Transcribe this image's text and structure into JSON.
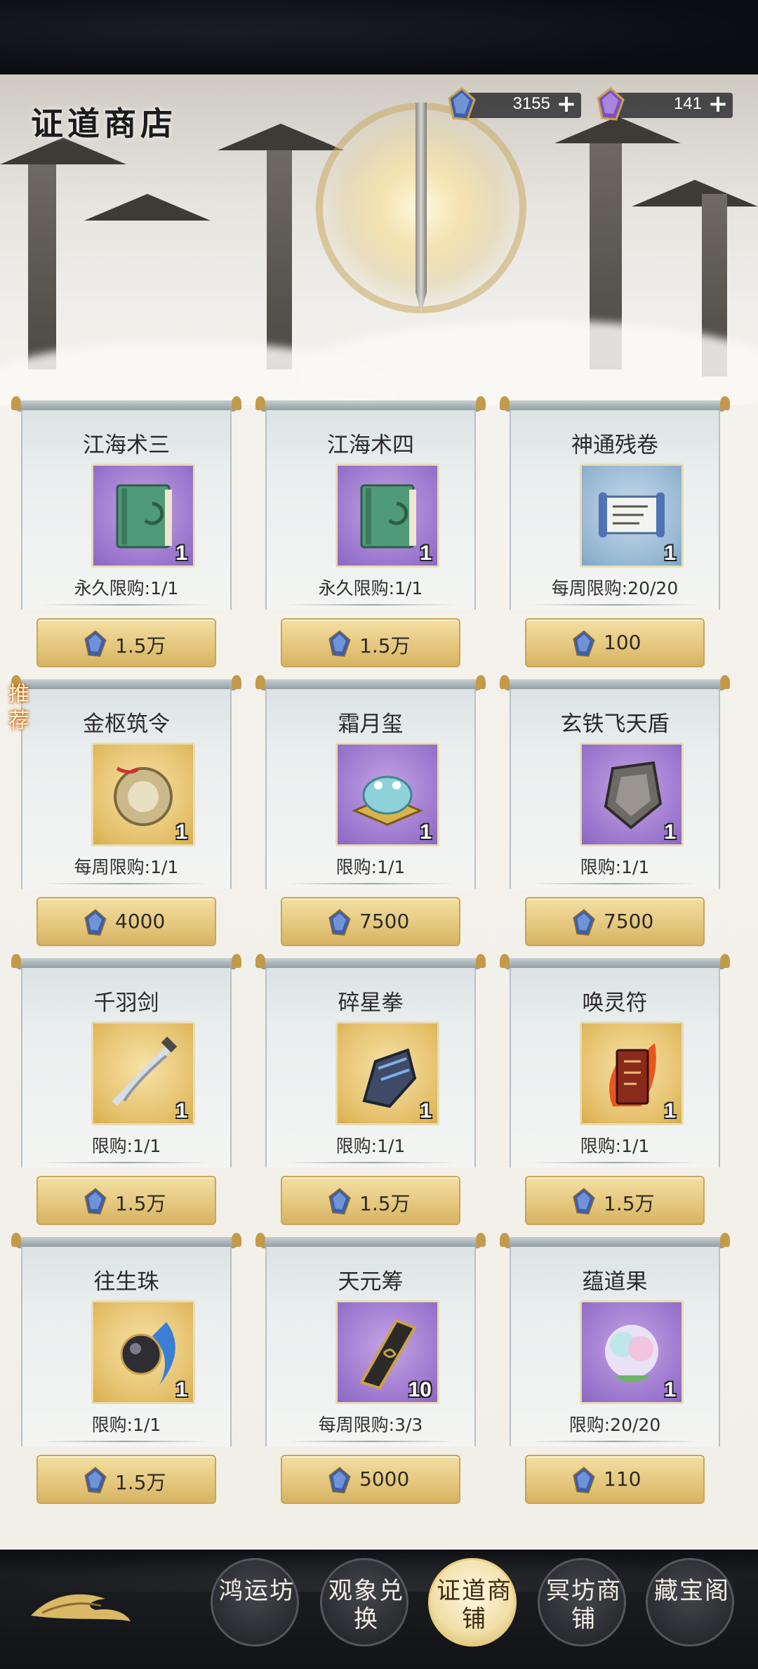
{
  "header": {
    "title": "证道商店",
    "currencies": [
      {
        "icon": "blue-crystal-icon",
        "amount": "3155",
        "plus": "+"
      },
      {
        "icon": "purple-crystal-icon",
        "amount": "141",
        "plus": "+"
      }
    ]
  },
  "recommend_tag": "推荐",
  "items": [
    {
      "name": "江海术三",
      "icon": "green-book-icon",
      "rarity": "purple",
      "qty": "1",
      "limit": "永久限购:1/1",
      "price": "1.5万"
    },
    {
      "name": "江海术四",
      "icon": "green-book-icon",
      "rarity": "purple",
      "qty": "1",
      "limit": "永久限购:1/1",
      "price": "1.5万"
    },
    {
      "name": "神通残卷",
      "icon": "scroll-icon",
      "rarity": "blue",
      "qty": "1",
      "limit": "每周限购:20/20",
      "price": "100"
    },
    {
      "name": "金枢筑令",
      "icon": "golden-token-icon",
      "rarity": "gold",
      "qty": "1",
      "limit": "每周限购:1/1",
      "price": "4000"
    },
    {
      "name": "霜月玺",
      "icon": "frog-seal-icon",
      "rarity": "purple",
      "qty": "1",
      "limit": "限购:1/1",
      "price": "7500"
    },
    {
      "name": "玄铁飞天盾",
      "icon": "shield-icon",
      "rarity": "purple",
      "qty": "1",
      "limit": "限购:1/1",
      "price": "7500"
    },
    {
      "name": "千羽剑",
      "icon": "feather-sword-icon",
      "rarity": "gold",
      "qty": "1",
      "limit": "限购:1/1",
      "price": "1.5万"
    },
    {
      "name": "碎星拳",
      "icon": "gauntlet-icon",
      "rarity": "gold",
      "qty": "1",
      "limit": "限购:1/1",
      "price": "1.5万"
    },
    {
      "name": "唤灵符",
      "icon": "flame-talisman-icon",
      "rarity": "gold",
      "qty": "1",
      "limit": "限购:1/1",
      "price": "1.5万"
    },
    {
      "name": "往生珠",
      "icon": "orb-icon",
      "rarity": "gold",
      "qty": "1",
      "limit": "限购:1/1",
      "price": "1.5万"
    },
    {
      "name": "天元筹",
      "icon": "black-tablet-icon",
      "rarity": "purple",
      "qty": "10",
      "limit": "每周限购:3/3",
      "price": "5000"
    },
    {
      "name": "蕴道果",
      "icon": "peach-fruit-icon",
      "rarity": "purple",
      "qty": "1",
      "limit": "限购:20/20",
      "price": "110"
    }
  ],
  "nav": [
    {
      "label": "鸿运坊",
      "active": false
    },
    {
      "label": "观象兑换",
      "active": false
    },
    {
      "label": "证道商铺",
      "active": true
    },
    {
      "label": "冥坊商铺",
      "active": false
    },
    {
      "label": "藏宝阁",
      "active": false
    }
  ],
  "colors": {
    "accent_gold": "#e4c67c",
    "purple_slot": "#9d78cf",
    "gold_slot": "#e5c16d",
    "blue_slot": "#98b9d4"
  }
}
